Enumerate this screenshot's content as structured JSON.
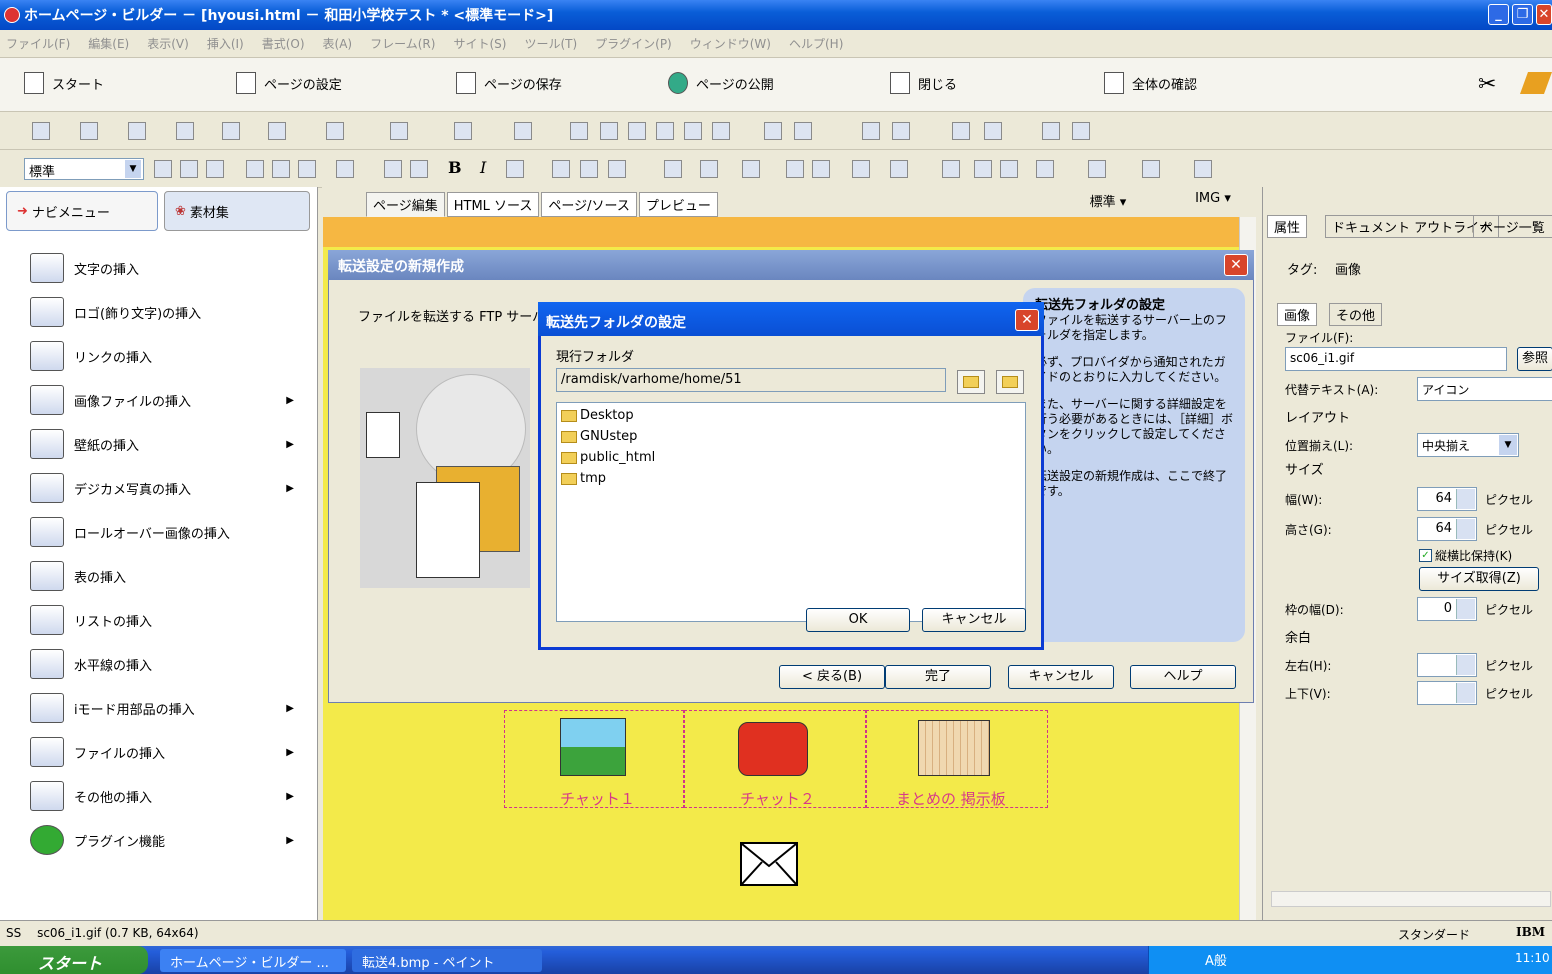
{
  "window": {
    "title": "ホームページ・ビルダー － [hyousi.html － 和田小学校テスト * <標準モード>]"
  },
  "menu": [
    "ファイル(F)",
    "編集(E)",
    "表示(V)",
    "挿入(I)",
    "書式(O)",
    "表(A)",
    "フレーム(R)",
    "サイト(S)",
    "ツール(T)",
    "プラグイン(P)",
    "ウィンドウ(W)",
    "ヘルプ(H)"
  ],
  "bigbar": {
    "start": "スタート",
    "page_settings": "ページの設定",
    "save_page": "ページの保存",
    "publish": "ページの公開",
    "close": "閉じる",
    "overview": "全体の確認"
  },
  "format": {
    "style_select": "標準",
    "bold": "B",
    "italic": "I"
  },
  "sidebar": {
    "tab_nav": "ナビメニュー",
    "tab_material": "素材集",
    "items": [
      {
        "label": "文字の挿入",
        "arrow": ""
      },
      {
        "label": "ロゴ(飾り文字)の挿入",
        "arrow": ""
      },
      {
        "label": "リンクの挿入",
        "arrow": ""
      },
      {
        "label": "画像ファイルの挿入",
        "arrow": "▶"
      },
      {
        "label": "壁紙の挿入",
        "arrow": "▶"
      },
      {
        "label": "デジカメ写真の挿入",
        "arrow": "▶"
      },
      {
        "label": "ロールオーバー画像の挿入",
        "arrow": ""
      },
      {
        "label": "表の挿入",
        "arrow": ""
      },
      {
        "label": "リストの挿入",
        "arrow": ""
      },
      {
        "label": "水平線の挿入",
        "arrow": ""
      },
      {
        "label": "iモード用部品の挿入",
        "arrow": "▶"
      },
      {
        "label": "ファイルの挿入",
        "arrow": "▶"
      },
      {
        "label": "その他の挿入",
        "arrow": "▶"
      },
      {
        "label": "プラグイン機能",
        "arrow": "▶"
      }
    ]
  },
  "editor_tabs": [
    "ページ編集",
    "HTML ソース",
    "ページ/ソース",
    "プレビュー"
  ],
  "editor_selects": {
    "style": "標準",
    "tag": "IMG"
  },
  "wizard": {
    "title": "転送設定の新規作成",
    "intro": "ファイルを転送する FTP サーバ",
    "info_title": "転送先フォルダの設定",
    "info_text1": "ファイルを転送するサーバー上のフォルダを指定します。",
    "info_text2": "必ず、プロバイダから通知されたガイドのとおりに入力してください。",
    "info_text3": "また、サーバーに関する詳細設定を行う必要があるときには、［詳細］ボタンをクリックして設定してください。",
    "info_text4": "転送設定の新規作成は、ここで終了です。",
    "back": "< 戻る(B)",
    "finish": "完了",
    "cancel": "キャンセル",
    "help": "ヘルプ"
  },
  "folder_dialog": {
    "title": "転送先フォルダの設定",
    "current_label": "現行フォルダ",
    "current_path": "/ramdisk/varhome/home/51",
    "folders": [
      "Desktop",
      "GNUstep",
      "public_html",
      "tmp"
    ],
    "ok": "OK",
    "cancel": "キャンセル"
  },
  "canvas": {
    "captions": [
      "チャット１",
      "チャット２",
      "まとめの 掲示板"
    ],
    "mail": "メール"
  },
  "props": {
    "tabs": [
      "属性",
      "ドキュメント アウトライナ",
      "ページ一覧"
    ],
    "tag_label": "タグ:",
    "tag_value": "画像",
    "subtabs": [
      "画像",
      "その他"
    ],
    "file_label": "ファイル(F):",
    "file_value": "sc06_i1.gif",
    "browse": "参照",
    "alt_label": "代替テキスト(A):",
    "alt_value": "アイコン",
    "layout": "レイアウト",
    "align_label": "位置揃え(L):",
    "align_value": "中央揃え",
    "size": "サイズ",
    "width_label": "幅(W):",
    "width_value": "64",
    "unit": "ピクセル",
    "height_label": "高さ(G):",
    "height_value": "64",
    "keep_ratio": "縦横比保持(K)",
    "get_size": "サイズ取得(Z)",
    "border_label": "枠の幅(D):",
    "border_value": "0",
    "margin": "余白",
    "lr_label": "左右(H):",
    "ud_label": "上下(V):"
  },
  "status": {
    "mode": "SS",
    "file": "sc06_i1.gif (0.7 KB, 64x64)",
    "standard": "スタンダード",
    "ibm": "IBM"
  },
  "taskbar": {
    "start": "スタート",
    "item1": "ホームページ・ビルダー ...",
    "item2": "転送4.bmp - ペイント",
    "ime": "A般",
    "time": "11:10"
  }
}
